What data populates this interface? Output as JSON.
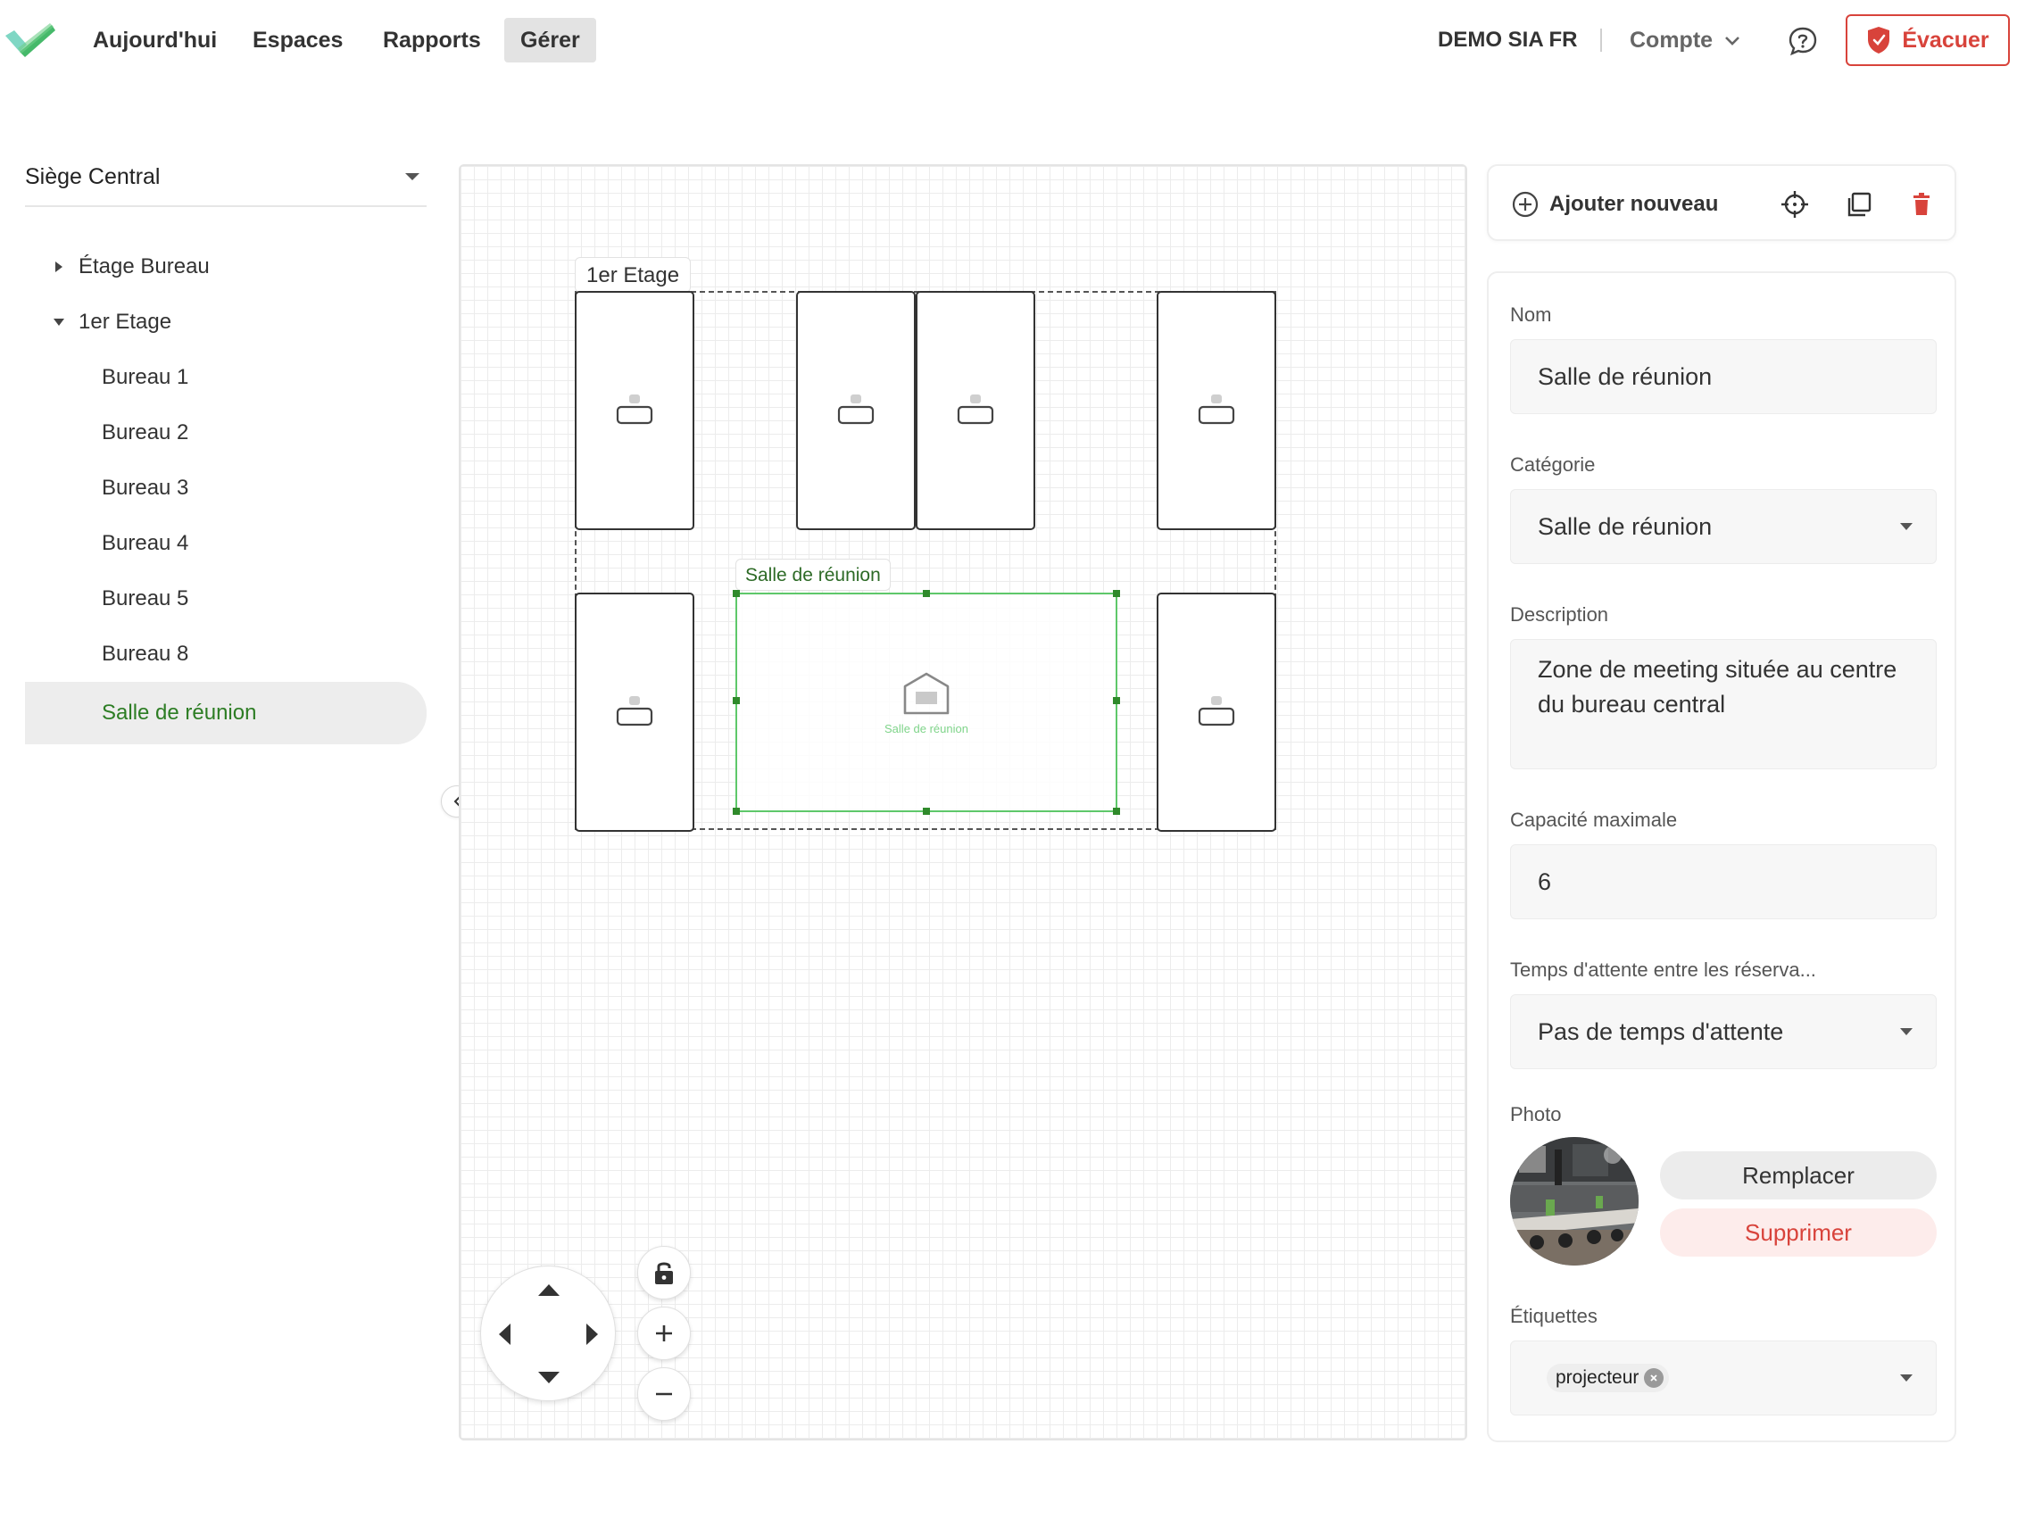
{
  "nav": {
    "items": [
      {
        "label": "Aujourd'hui"
      },
      {
        "label": "Espaces"
      },
      {
        "label": "Rapports"
      },
      {
        "label": "Gérer"
      }
    ],
    "active": "Gérer",
    "org_name": "DEMO SIA FR",
    "account_label": "Compte",
    "evacuate_label": "Évacuer",
    "colors": {
      "brand_green": "#4cc49a",
      "danger": "#d8433b"
    }
  },
  "sidebar": {
    "site_select": "Siège Central",
    "tree": [
      {
        "label": "Étage Bureau",
        "expanded": false
      },
      {
        "label": "1er Etage",
        "expanded": true
      },
      {
        "label": "Bureau 1"
      },
      {
        "label": "Bureau 2"
      },
      {
        "label": "Bureau 3"
      },
      {
        "label": "Bureau 4"
      },
      {
        "label": "Bureau 5"
      },
      {
        "label": "Bureau 8"
      },
      {
        "label": "Salle de réunion",
        "selected": true
      }
    ]
  },
  "canvas": {
    "floor_label": "1er Etage",
    "room_label": "Salle de réunion",
    "room_inner_text": "Salle de réunion"
  },
  "toolbar": {
    "add_new_label": "Ajouter nouveau"
  },
  "form": {
    "name_label": "Nom",
    "name_value": "Salle de réunion",
    "category_label": "Catégorie",
    "category_value": "Salle de réunion",
    "description_label": "Description",
    "description_value": "Zone de meeting située au centre du bureau central",
    "capacity_label": "Capacité maximale",
    "capacity_value": "6",
    "wait_label": "Temps d'attente entre les réserva...",
    "wait_value": "Pas de temps d'attente",
    "photo_label": "Photo",
    "replace_label": "Remplacer",
    "delete_label": "Supprimer",
    "tags_label": "Étiquettes",
    "tags": [
      "projecteur"
    ]
  }
}
